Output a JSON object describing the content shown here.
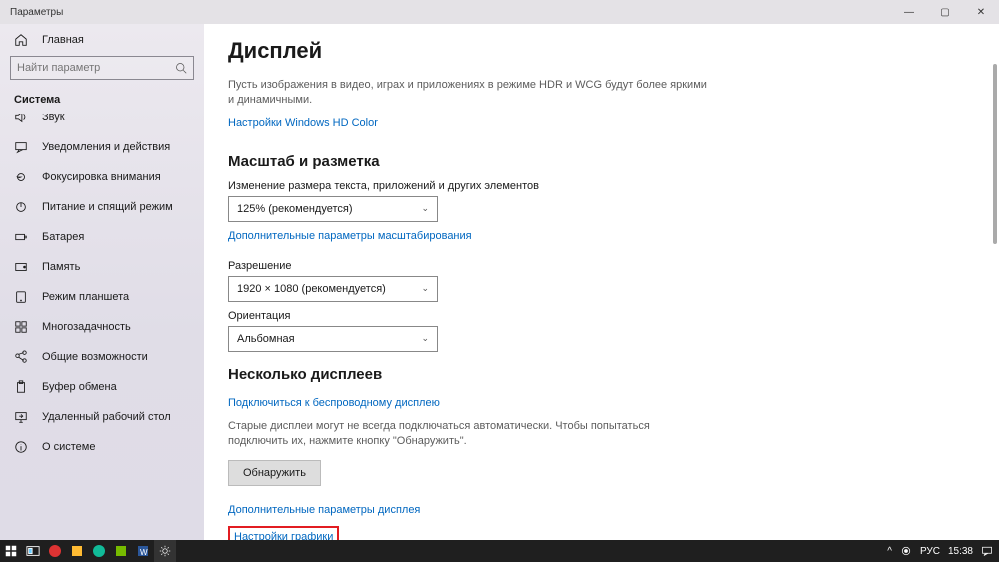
{
  "window": {
    "title": "Параметры",
    "sysbuttons": {
      "min": "—",
      "max": "▢",
      "close": "✕"
    }
  },
  "sidebar": {
    "home": "Главная",
    "search_placeholder": "Найти параметр",
    "category": "Система",
    "items": [
      {
        "id": "sound",
        "label": "Звук"
      },
      {
        "id": "notifications",
        "label": "Уведомления и действия"
      },
      {
        "id": "focus",
        "label": "Фокусировка внимания"
      },
      {
        "id": "power",
        "label": "Питание и спящий режим"
      },
      {
        "id": "battery",
        "label": "Батарея"
      },
      {
        "id": "storage",
        "label": "Память"
      },
      {
        "id": "tablet",
        "label": "Режим планшета"
      },
      {
        "id": "multitask",
        "label": "Многозадачность"
      },
      {
        "id": "shared",
        "label": "Общие возможности"
      },
      {
        "id": "clipboard",
        "label": "Буфер обмена"
      },
      {
        "id": "remote",
        "label": "Удаленный рабочий стол"
      },
      {
        "id": "about",
        "label": "О системе"
      }
    ]
  },
  "content": {
    "title": "Дисплей",
    "hdr_desc": "Пусть изображения в видео, играх и приложениях в режиме HDR и WCG будут более яркими и динамичными.",
    "hdr_link": "Настройки Windows HD Color",
    "scale_heading": "Масштаб и разметка",
    "scale_label": "Изменение размера текста, приложений и других элементов",
    "scale_value": "125% (рекомендуется)",
    "scale_link": "Дополнительные параметры масштабирования",
    "res_label": "Разрешение",
    "res_value": "1920 × 1080 (рекомендуется)",
    "orient_label": "Ориентация",
    "orient_value": "Альбомная",
    "multi_heading": "Несколько дисплеев",
    "multi_link": "Подключиться к беспроводному дисплею",
    "multi_desc": "Старые дисплеи могут не всегда подключаться автоматически. Чтобы попытаться подключить их, нажмите кнопку \"Обнаружить\".",
    "detect_btn": "Обнаружить",
    "adv_link": "Дополнительные параметры дисплея",
    "gfx_link": "Настройки графики"
  },
  "taskbar": {
    "lang": "РУС",
    "time": "15:38"
  }
}
